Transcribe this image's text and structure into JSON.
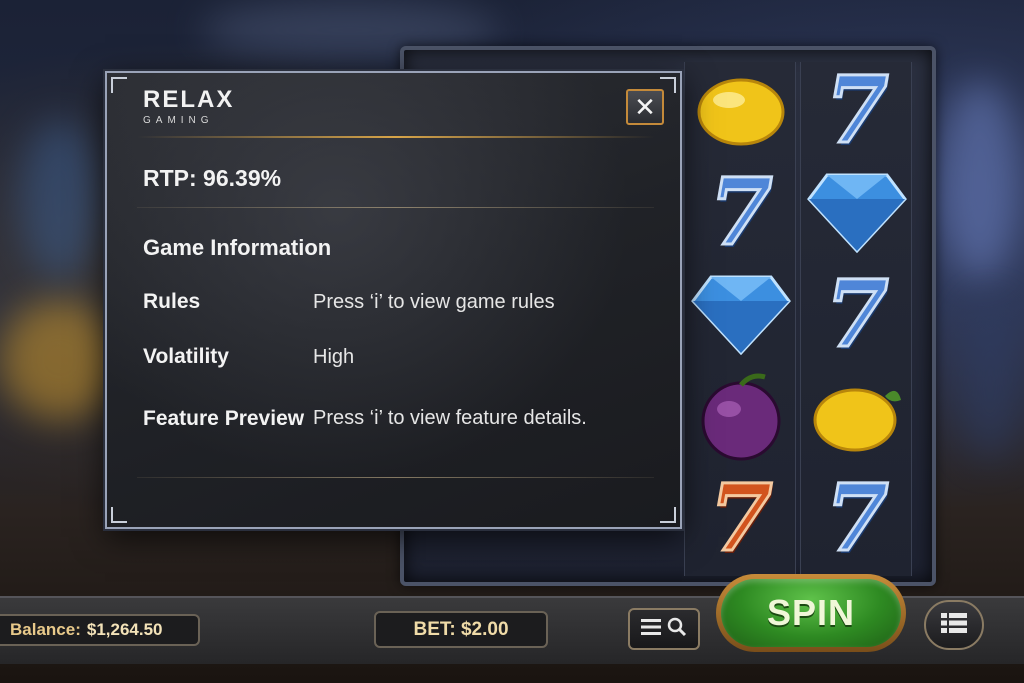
{
  "brand": {
    "logo_main": "RELAX",
    "logo_sub": "GAMING"
  },
  "dialog": {
    "close_label": "✕",
    "rtp": "RTP: 96.39%",
    "section_title": "Game Information",
    "rows": [
      {
        "label": "Rules",
        "value": "Press ‘i’ to view game rules"
      },
      {
        "label": "Volatility",
        "value": "High"
      },
      {
        "label": "Feature Preview",
        "value": "Press ‘i’ to view feature details."
      }
    ]
  },
  "reels": {
    "symbols_visible": [
      "lemon",
      "seven-blue",
      "diamond",
      "plum",
      "seven-red",
      "seven-blue",
      "diamond",
      "seven-blue",
      "lemon",
      "seven-blue"
    ]
  },
  "footer": {
    "balance_label": "Balance:",
    "balance_value": "$1,264.50",
    "bet_label": "BET: $2.00",
    "spin_label": "SPIN",
    "icons": [
      "menu-icon",
      "search-icon",
      "paytable-icon"
    ]
  },
  "colors": {
    "accent_gold": "#d7a448",
    "spin_green": "#2e8a22",
    "dialog_border": "#9aa3b8"
  }
}
